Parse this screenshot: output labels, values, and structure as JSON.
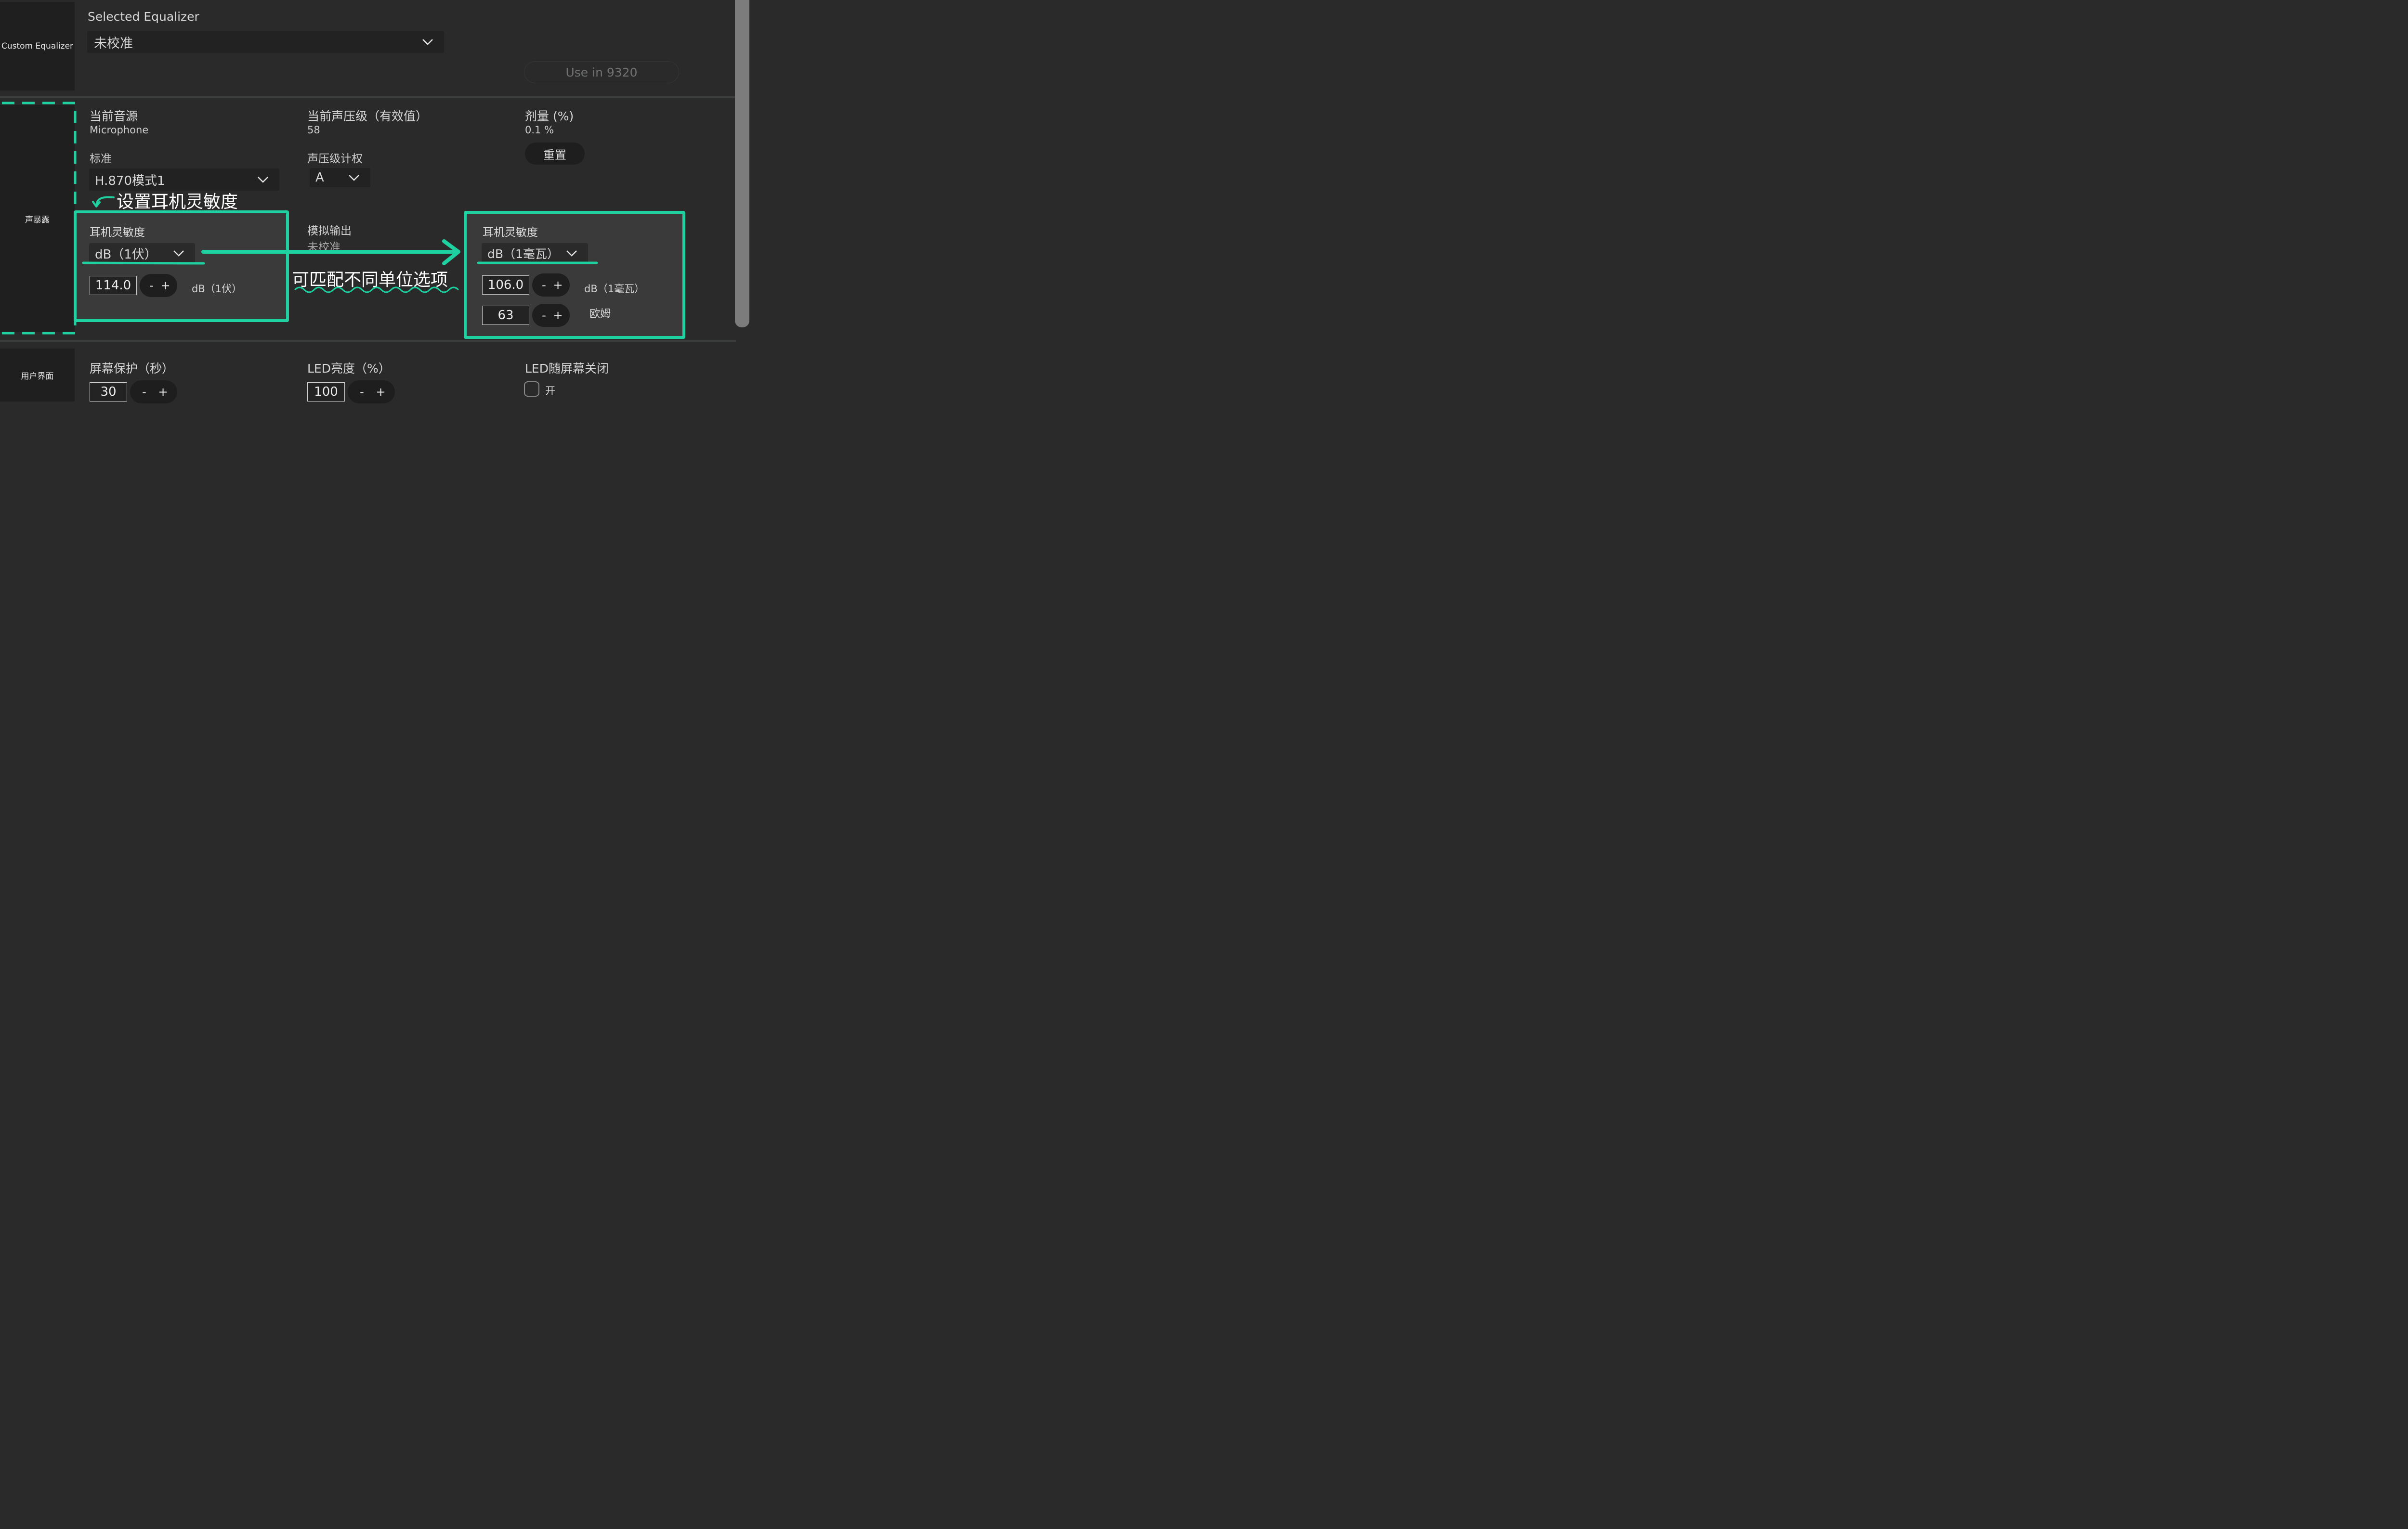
{
  "equalizer": {
    "side_label": "Custom Equalizer",
    "section_label": "Selected Equalizer",
    "selected": "未校准",
    "use_button": "Use in 9320"
  },
  "exposure": {
    "side_label": "声暴露",
    "current_source_label": "当前音源",
    "current_source_value": "Microphone",
    "spl_label": "当前声压级（有效值）",
    "spl_value": "58",
    "dose_label": "剂量 (%)",
    "dose_value": "0.1 %",
    "reset_button": "重置",
    "standard_label": "标准",
    "standard_value": "H.870模式1",
    "weighting_label": "声压级计权",
    "weighting_value": "A",
    "analog_out_label": "模拟输出",
    "analog_out_value": "未校准",
    "left_panel": {
      "title": "耳机灵敏度",
      "unit_select": "dB（1伏）",
      "value": "114.0",
      "unit": "dB（1伏）"
    },
    "right_panel": {
      "title": "耳机灵敏度",
      "unit_select": "dB（1毫瓦）",
      "value": "106.0",
      "unit": "dB（1毫瓦）",
      "impedance_value": "63",
      "impedance_unit": "欧姆"
    }
  },
  "ui": {
    "side_label": "用户界面",
    "screensaver_label": "屏幕保护（秒）",
    "screensaver_value": "30",
    "led_brightness_label": "LED亮度（%）",
    "led_brightness_value": "100",
    "led_off_label": "LED随屏幕关闭",
    "led_off_checkbox_label": "开"
  },
  "stepper": {
    "minus": "-",
    "plus": "+"
  },
  "annotations": {
    "set_sensitivity": "设置耳机灵敏度",
    "match_units": "可匹配不同单位选项"
  },
  "colors": {
    "highlight": "#1fd1a0",
    "background": "#2a2a2a",
    "panel": "#1f1f1f"
  }
}
